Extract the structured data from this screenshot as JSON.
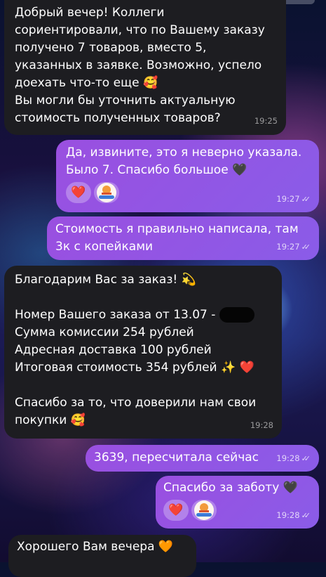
{
  "messages": [
    {
      "lines": [
        "Добрый вечер! Коллеги",
        "сориентировали, что по Вашему заказу",
        "получено 7 товаров, вместо 5,",
        "указанных в заявке. Возможно, успело",
        "доехать что-то еще 🥰",
        "Вы могли бы уточнить актуальную",
        "стоимость полученных товаров?"
      ],
      "time": "19:25"
    },
    {
      "lines": [
        "Да, извините, это я неверно указала.",
        "Было 7. Спасибо большое 🖤"
      ],
      "reactions": [
        "❤️",
        "avatar"
      ],
      "time": "19:27"
    },
    {
      "lines": [
        "Стоимость я правильно написала, там",
        "3к с копейками"
      ],
      "time": "19:27"
    },
    {
      "lines": [
        "Благодарим Вас за заказ! 💫",
        "",
        "Номер Вашего заказа от 13.07 -",
        "Сумма комиссии 254 рублей",
        "Адресная доставка 100 рублей",
        "Итоговая стоимость 354 рублей ✨ ❤️",
        "",
        "Спасибо за то, что доверили нам свои",
        "покупки 🥰"
      ],
      "time": "19:28"
    },
    {
      "lines": [
        "3639, пересчитала сейчас"
      ],
      "time": "19:28"
    },
    {
      "lines": [
        "Спасибо за заботу 🖤"
      ],
      "reactions": [
        "❤️",
        "avatar"
      ],
      "time": "19:28"
    },
    {
      "lines": [
        "Хорошего Вам вечера 🧡"
      ]
    }
  ],
  "icons": {
    "read_receipt": "double-check-icon",
    "reaction_avatar": "shop-logo-avatar-icon"
  },
  "colors": {
    "incoming_bubble": "#1d1d21",
    "outgoing_bubble": "#9a4fe0"
  }
}
